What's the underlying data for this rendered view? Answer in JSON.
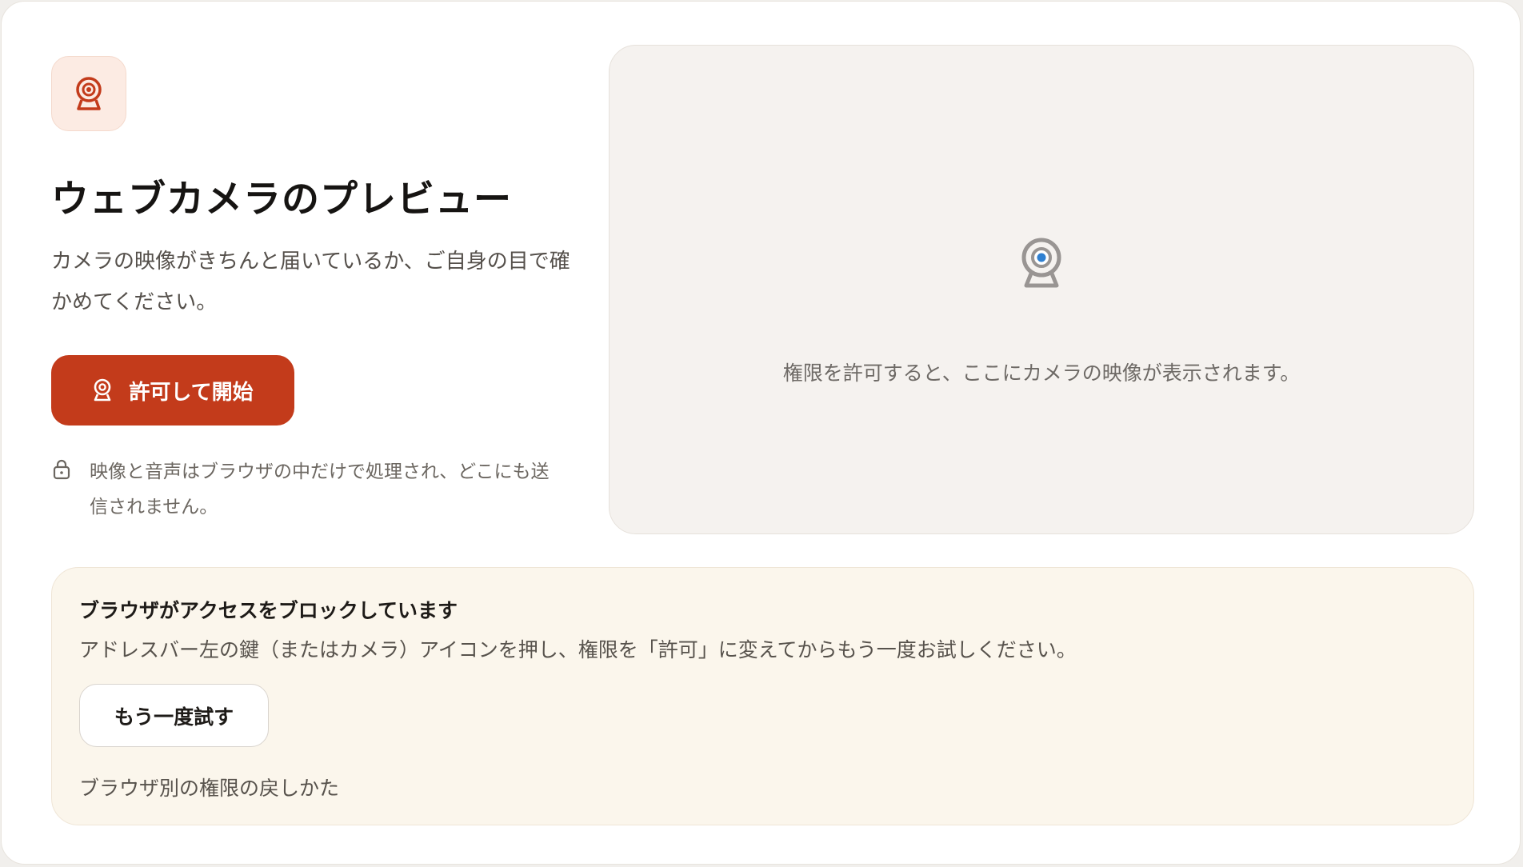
{
  "header": {
    "icon": "webcam-icon",
    "title": "ウェブカメラのプレビュー",
    "description": "カメラの映像がきちんと届いているか、ご自身の目で確かめてください。"
  },
  "actions": {
    "start_icon": "webcam-icon",
    "start_label": "許可して開始"
  },
  "privacy": {
    "icon": "lock-icon",
    "text": "映像と音声はブラウザの中だけで処理され、どこにも送信されません。"
  },
  "preview": {
    "icon": "webcam-icon",
    "placeholder": "権限を許可すると、ここにカメラの映像が表示されます。"
  },
  "alert": {
    "title": "ブラウザがアクセスをブロックしています",
    "body": "アドレスバー左の鍵（またはカメラ）アイコンを押し、権限を「許可」に変えてからもう一度お試しください。",
    "retry_label": "もう一度試す",
    "help_link": "ブラウザ別の権限の戻しかた"
  },
  "colors": {
    "accent": "#c33b1b",
    "accent_soft": "#fcebe3",
    "preview_bg": "#f5f2ef",
    "alert_bg": "#fbf6ec",
    "camera_lens": "#2f80d1"
  }
}
